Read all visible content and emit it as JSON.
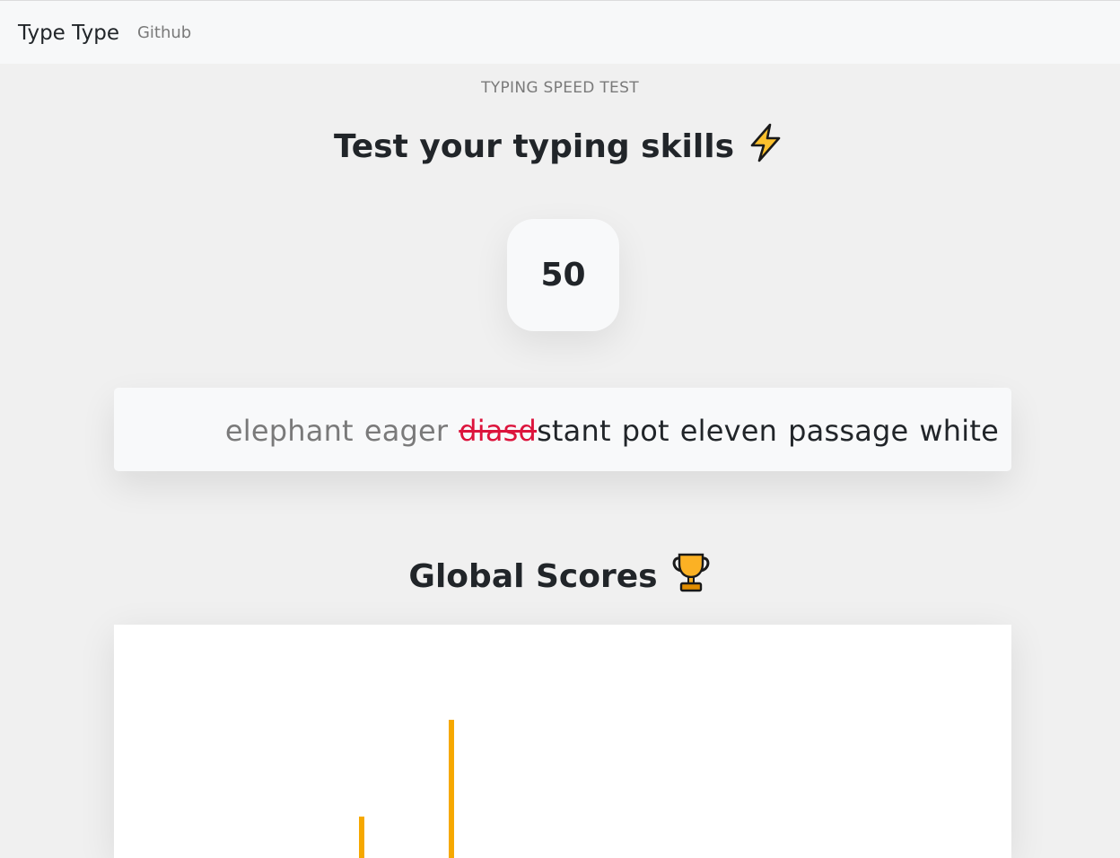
{
  "navbar": {
    "brand": "Type Type",
    "github_link": "Github"
  },
  "hero": {
    "eyebrow": "TYPING SPEED TEST",
    "title": "Test your typing skills",
    "title_icon": "lightning-icon"
  },
  "timer": {
    "value": "50"
  },
  "typing": {
    "completed_words": [
      "elephant",
      "eager"
    ],
    "current_word": {
      "typed_wrong": "diasd",
      "remaining": "stant"
    },
    "upcoming_words": [
      "pot",
      "eleven",
      "passage",
      "white"
    ],
    "colors": {
      "completed": "#7a7a7a",
      "error": "#dc143c",
      "pending": "#212529"
    }
  },
  "scores": {
    "title": "Global Scores",
    "title_icon": "trophy-icon"
  },
  "chart_data": {
    "type": "bar",
    "bar_color": "#f6a800",
    "values_relative": [
      0.3,
      1.0
    ]
  }
}
